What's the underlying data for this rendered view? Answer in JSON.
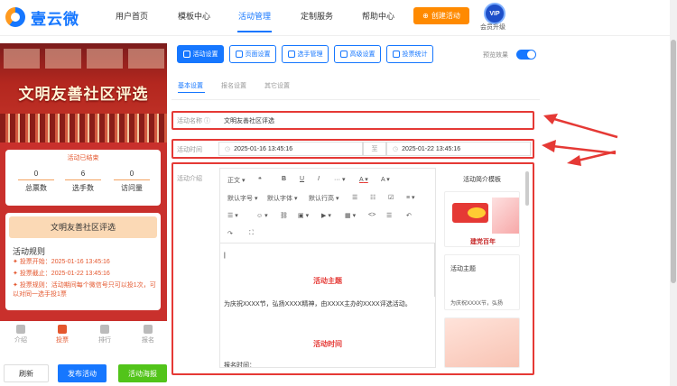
{
  "nav": {
    "logo": "壹云微",
    "items": [
      "用户首页",
      "模板中心",
      "活动管理",
      "定制服务",
      "帮助中心"
    ],
    "active_index": 2,
    "create_button": "创建活动",
    "vip_badge": "VIP",
    "vip_label": "会员升级"
  },
  "preview": {
    "banner_title": "文明友善社区评选",
    "status": "活动已结束",
    "stats": [
      {
        "value": "0",
        "label": "总票数"
      },
      {
        "value": "6",
        "label": "选手数"
      },
      {
        "value": "0",
        "label": "访问量"
      }
    ],
    "rules_header": "文明友善社区评选",
    "rules_title": "活动规则",
    "rules": [
      "投票开始：2025-01-16 13:45:16",
      "投票截止：2025-01-22 13:45:16",
      "投票规则：活动期间每个微信号只可以投1次，可以对同一选手投1票"
    ],
    "tabs": [
      "介绍",
      "投票",
      "排行",
      "报名"
    ],
    "active_tab": 1
  },
  "bottom_buttons": {
    "refresh": "刷新",
    "publish": "发布活动",
    "poster": "活动海报"
  },
  "toolbar_buttons": [
    "活动设置",
    "页面设置",
    "选手管理",
    "高级设置",
    "投票统计"
  ],
  "preview_effect_label": "预览效果",
  "sub_tabs": [
    "基本设置",
    "报名设置",
    "其它设置"
  ],
  "form": {
    "name_label": "活动名称",
    "name_value": "文明友善社区评选",
    "time_label": "活动时间",
    "start_time": "2025-01-16 13:45:16",
    "to": "至",
    "end_time": "2025-01-22 13:45:16",
    "intro_label": "活动介绍"
  },
  "editor": {
    "toolbar_row1": [
      "正文",
      "❝",
      "B",
      "U",
      "I",
      "···",
      "A",
      "A"
    ],
    "toolbar_row2": [
      "默认字号",
      "默认字体",
      "默认行高",
      "☰",
      "☷",
      "☑",
      "≡"
    ],
    "toolbar_row3": [
      "☰",
      "☺",
      "⛓",
      "▣",
      "▶",
      "▦",
      "<>",
      "☰",
      "↶"
    ],
    "toolbar_row4": [
      "↷",
      "⛶"
    ],
    "heading1": "活动主题",
    "body1": "为庆祝XXXX节，弘扬XXXX精神，由XXXX主办的XXXX评选活动。",
    "heading2": "活动时间",
    "body2": "报名时间："
  },
  "templates": {
    "title": "活动简介模板",
    "card1_text": "建党百年",
    "card2_title": "活动主题",
    "card2_text": "为庆祝XXXX节，弘扬"
  },
  "colors": {
    "primary": "#1677ff",
    "accent": "#ff8a00",
    "highlight": "#e53935"
  }
}
